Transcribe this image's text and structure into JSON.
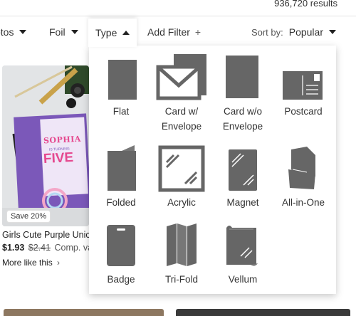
{
  "header": {
    "results_text": "936,720 results"
  },
  "filter_bar": {
    "photos_label": "otos",
    "foil_label": "Foil",
    "type_label": "Type",
    "add_filter_label": "Add Filter",
    "sort_by_label": "Sort by:",
    "sort_value": "Popular"
  },
  "type_menu": {
    "items": [
      {
        "label": "Flat",
        "icon": "flat-card-icon"
      },
      {
        "label": "Card w/ Envelope",
        "icon": "card-with-envelope-icon"
      },
      {
        "label": "Card w/o Envelope",
        "icon": "card-without-envelope-icon"
      },
      {
        "label": "Postcard",
        "icon": "postcard-icon"
      },
      {
        "label": "Folded",
        "icon": "folded-card-icon"
      },
      {
        "label": "Acrylic",
        "icon": "acrylic-card-icon"
      },
      {
        "label": "Magnet",
        "icon": "magnet-card-icon"
      },
      {
        "label": "All-in-One",
        "icon": "all-in-one-card-icon"
      },
      {
        "label": "Badge",
        "icon": "badge-card-icon"
      },
      {
        "label": "Tri-Fold",
        "icon": "tri-fold-card-icon"
      },
      {
        "label": "Vellum",
        "icon": "vellum-card-icon"
      }
    ]
  },
  "product": {
    "sale_badge": "Save 20%",
    "title": "Girls Cute Purple Unico",
    "price": "$1.93",
    "old_price": "$2.41",
    "comp_text": "Comp. value C",
    "more_like": "More like this",
    "card_name": "SOPHIA",
    "card_tag": "IS TURNING",
    "card_age": "FIVE"
  },
  "colors": {
    "icon_gray": "#666666",
    "accent_purple": "#7b58b9",
    "pink": "#e5498f"
  }
}
